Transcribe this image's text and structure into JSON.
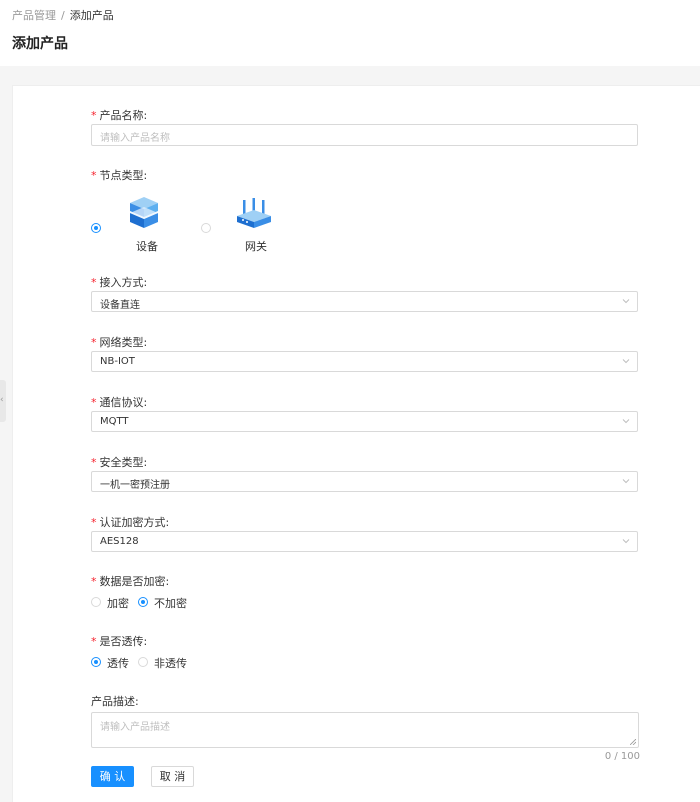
{
  "breadcrumb": {
    "parent": "产品管理",
    "separator": "/",
    "current": "添加产品"
  },
  "page_title": "添加产品",
  "form": {
    "product_name": {
      "label": "产品名称:",
      "placeholder": "请输入产品名称"
    },
    "node_type": {
      "label": "节点类型:",
      "options": [
        {
          "label": "设备",
          "icon": "device-icon",
          "selected": true
        },
        {
          "label": "网关",
          "icon": "gateway-router-icon",
          "selected": false
        }
      ]
    },
    "access_method": {
      "label": "接入方式:",
      "value": "设备直连"
    },
    "network_type": {
      "label": "网络类型:",
      "value": "NB-IOT"
    },
    "protocol": {
      "label": "通信协议:",
      "value": "MQTT"
    },
    "security_type": {
      "label": "安全类型:",
      "value": "一机一密预注册"
    },
    "auth_encryption": {
      "label": "认证加密方式:",
      "value": "AES128"
    },
    "data_encrypt": {
      "label": "数据是否加密:",
      "options": [
        {
          "label": "加密",
          "selected": false
        },
        {
          "label": "不加密",
          "selected": true
        }
      ]
    },
    "passthrough": {
      "label": "是否透传:",
      "options": [
        {
          "label": "透传",
          "selected": true
        },
        {
          "label": "非透传",
          "selected": false
        }
      ]
    },
    "description": {
      "label": "产品描述:",
      "placeholder": "请输入产品描述",
      "counter": "0 / 100"
    },
    "required_mark": "*"
  },
  "actions": {
    "confirm": "确 认",
    "cancel": "取 消"
  },
  "colors": {
    "primary": "#1890ff",
    "required": "#f5222d"
  }
}
